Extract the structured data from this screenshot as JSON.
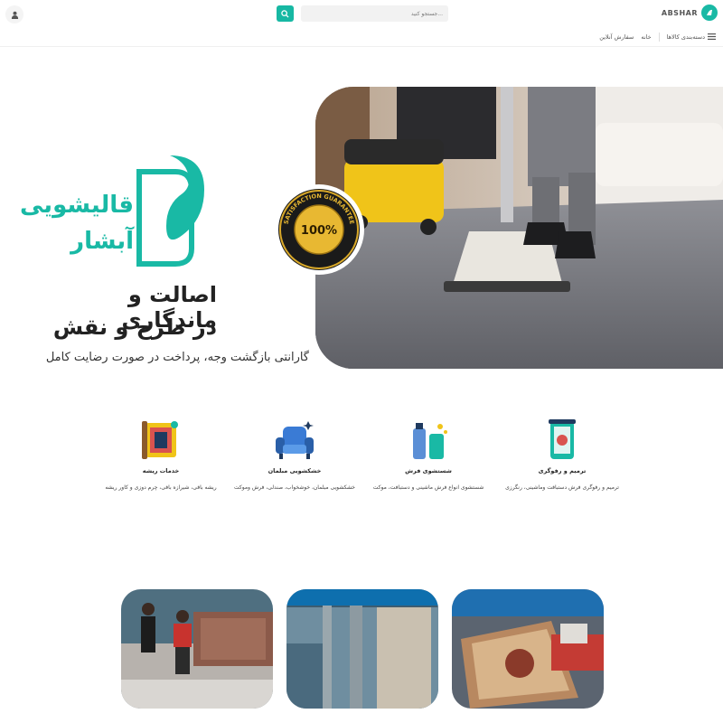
{
  "header": {
    "brand": "ABSHAR",
    "search_placeholder": "جستجو کنید...",
    "nav": [
      {
        "label": "دسته‌بندی کالاها"
      },
      {
        "label": "خانه"
      },
      {
        "label": "سفارش آنلاین"
      }
    ]
  },
  "hero": {
    "logo_line1": "قالیشویی",
    "logo_line2": "آبشار",
    "headline_line1": "اصالت و ماندگاری",
    "headline_line2": "در طرح و نقش",
    "subline": "گارانتی بازگشت وجه، پرداخت در صورت رضایت کامل",
    "seal_text": "100%",
    "seal_ring_text": "SATISFACTION GUARANTEE"
  },
  "services": [
    {
      "title": "ترمیم و رفوگری",
      "desc": "ترمیم و رفوگری فرش دستبافت وماشینی، رنگرزی",
      "icon": "rug-roll-icon"
    },
    {
      "title": "شستشوی فرش",
      "desc": "شستشوی انواع فرش ماشینی و دستبافت، موکت",
      "icon": "spray-bottle-icon"
    },
    {
      "title": "خشکشویی مبلمان",
      "desc": "خشکشویی مبلمان، خوشخواب، صندلی، فرش وموکت",
      "icon": "armchair-icon"
    },
    {
      "title": "خدمات ریشه",
      "desc": "ریشه بافی، شیرازه بافی، چرم دوزی و کاور ریشه",
      "icon": "rug-fringe-icon"
    }
  ],
  "colors": {
    "accent": "#19b9a5",
    "text": "#222222"
  }
}
